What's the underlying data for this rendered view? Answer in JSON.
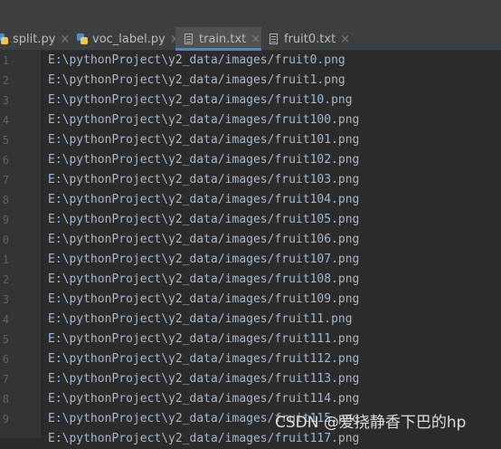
{
  "tabs": [
    {
      "label": "split.py",
      "icon": "python-file-icon",
      "active": false
    },
    {
      "label": "voc_label.py",
      "icon": "python-file-icon",
      "active": false
    },
    {
      "label": "train.txt",
      "icon": "text-file-icon",
      "active": true
    },
    {
      "label": "fruit0.txt",
      "icon": "text-file-icon",
      "active": false
    }
  ],
  "close_glyph": "×",
  "editor": {
    "line_numbers": [
      "1",
      "2",
      "3",
      "4",
      "5",
      "6",
      "7",
      "8",
      "9",
      "0",
      "1",
      "2",
      "3",
      "4",
      "5",
      "6",
      "7",
      "8",
      "9"
    ],
    "lines": [
      "E:\\pythonProject\\y2_data/images/fruit0.png",
      "E:\\pythonProject\\y2_data/images/fruit1.png",
      "E:\\pythonProject\\y2_data/images/fruit10.png",
      "E:\\pythonProject\\y2_data/images/fruit100.png",
      "E:\\pythonProject\\y2_data/images/fruit101.png",
      "E:\\pythonProject\\y2_data/images/fruit102.png",
      "E:\\pythonProject\\y2_data/images/fruit103.png",
      "E:\\pythonProject\\y2_data/images/fruit104.png",
      "E:\\pythonProject\\y2_data/images/fruit105.png",
      "E:\\pythonProject\\y2_data/images/fruit106.png",
      "E:\\pythonProject\\y2_data/images/fruit107.png",
      "E:\\pythonProject\\y2_data/images/fruit108.png",
      "E:\\pythonProject\\y2_data/images/fruit109.png",
      "E:\\pythonProject\\y2_data/images/fruit11.png",
      "E:\\pythonProject\\y2_data/images/fruit111.png",
      "E:\\pythonProject\\y2_data/images/fruit112.png",
      "E:\\pythonProject\\y2_data/images/fruit113.png",
      "E:\\pythonProject\\y2_data/images/fruit114.png",
      "E:\\pythonProject\\y2_data/images/fruit115.png",
      "E:\\pythonProject\\y2_data/images/fruit117.png"
    ]
  },
  "watermark": "CSDN @爱挠静香下巴的hp"
}
